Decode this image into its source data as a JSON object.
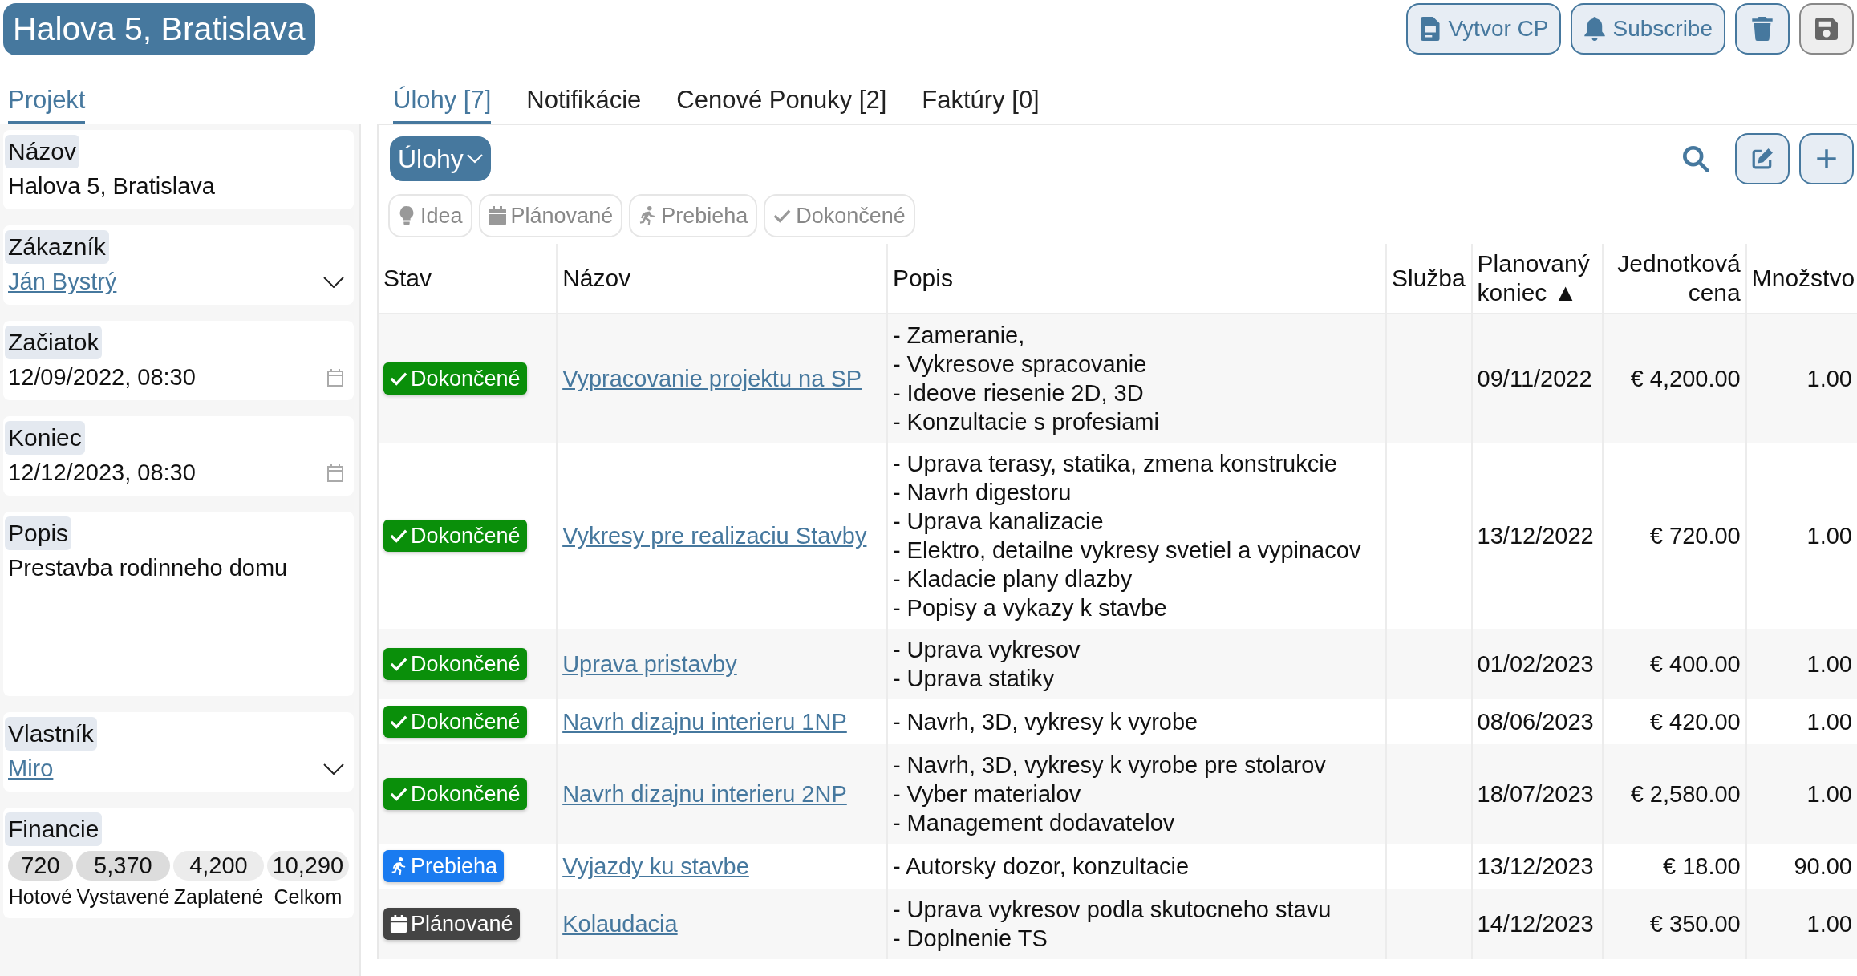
{
  "title": "Halova 5, Bratislava",
  "actions": [
    {
      "label": "Vytvor CP",
      "kind": "document"
    },
    {
      "label": "Subscribe",
      "kind": "bell"
    },
    {
      "kind": "trash"
    },
    {
      "kind": "save"
    }
  ],
  "sidebar": {
    "tabs": [
      {
        "label": "Projekt",
        "selected": true
      }
    ],
    "fields": [
      {
        "label": "Názov",
        "kind": "text",
        "value": "Halova 5, Bratislava"
      },
      {
        "label": "Zákazník",
        "kind": "link_select",
        "value": "Ján Bystrý"
      },
      {
        "label": "Začiatok",
        "kind": "date",
        "value": "12/09/2022, 08:30"
      },
      {
        "label": "Koniec",
        "kind": "date",
        "value": "12/12/2023, 08:30"
      },
      {
        "label": "Popis",
        "kind": "textarea",
        "value": "Prestavba rodinneho domu"
      },
      {
        "label": "Vlastník",
        "kind": "link_select",
        "value": "Miro"
      }
    ],
    "finance": {
      "label": "Financie",
      "items": [
        {
          "value": "720",
          "caption": "Hotové",
          "color": "#dcdcdc"
        },
        {
          "value": "5,370",
          "caption": "Vystavené",
          "color": "#dcdcdc"
        },
        {
          "value": "4,200",
          "caption": "Zaplatené",
          "color": "#ececec"
        },
        {
          "value": "10,290",
          "caption": "Celkom",
          "color": "#ececec"
        }
      ]
    }
  },
  "tabs": [
    {
      "label": "Úlohy [7]",
      "selected": true
    },
    {
      "label": "Notifikácie",
      "selected": false
    },
    {
      "label": "Cenové Ponuky [2]",
      "selected": false
    },
    {
      "label": "Faktúry [0]",
      "selected": false
    }
  ],
  "view_dropdown": "Úlohy",
  "filters": [
    {
      "label": "Idea",
      "kind": "idea"
    },
    {
      "label": "Plánované",
      "kind": "planned"
    },
    {
      "label": "Prebieha",
      "kind": "in_progress"
    },
    {
      "label": "Dokončené",
      "kind": "done"
    }
  ],
  "table": {
    "columns": [
      {
        "label": "Stav",
        "kind": "text"
      },
      {
        "label": "Názov",
        "kind": "text"
      },
      {
        "label": "Popis",
        "kind": "text"
      },
      {
        "label": "Služba",
        "kind": "text"
      },
      {
        "label": "Planovaný koniec",
        "kind": "text",
        "sort_mark": "▲"
      },
      {
        "label": "Jednotková cena",
        "kind": "numeric"
      },
      {
        "label": "Množstvo",
        "kind": "numeric"
      }
    ],
    "rows": [
      {
        "status": {
          "label": "Dokončené",
          "kind": "done"
        },
        "name": "Vypracovanie projektu na SP",
        "description": [
          "- Zameranie,",
          "- Vykresove spracovanie",
          "- Ideove riesenie 2D, 3D",
          "- Konzultacie s profesiami"
        ],
        "end": "09/11/2022",
        "price": "€ 4,200.00",
        "quantity": "1.00"
      },
      {
        "status": {
          "label": "Dokončené",
          "kind": "done"
        },
        "name": "Vykresy pre realizaciu Stavby",
        "description": [
          "- Uprava terasy, statika, zmena konstrukcie",
          "- Navrh digestoru",
          "- Uprava kanalizacie",
          "- Elektro, detailne vykresy svetiel a vypinacov",
          "- Kladacie plany dlazby",
          "- Popisy a vykazy k stavbe"
        ],
        "end": "13/12/2022",
        "price": "€ 720.00",
        "quantity": "1.00"
      },
      {
        "status": {
          "label": "Dokončené",
          "kind": "done"
        },
        "name": "Uprava pristavby",
        "description": [
          "- Uprava vykresov",
          "- Uprava statiky"
        ],
        "end": "01/02/2023",
        "price": "€ 400.00",
        "quantity": "1.00"
      },
      {
        "status": {
          "label": "Dokončené",
          "kind": "done"
        },
        "name": "Navrh dizajnu interieru 1NP",
        "description": [
          "- Navrh, 3D, vykresy k vyrobe"
        ],
        "end": "08/06/2023",
        "price": "€ 420.00",
        "quantity": "1.00"
      },
      {
        "status": {
          "label": "Dokončené",
          "kind": "done"
        },
        "name": "Navrh dizajnu interieru 2NP",
        "description": [
          "- Navrh, 3D, vykresy k vyrobe pre stolarov",
          "- Vyber materialov",
          "- Management dodavatelov"
        ],
        "end": "18/07/2023",
        "price": "€ 2,580.00",
        "quantity": "1.00"
      },
      {
        "status": {
          "label": "Prebieha",
          "kind": "in_progress"
        },
        "name": "Vyjazdy ku stavbe",
        "description": [
          "- Autorsky dozor,  konzultacie"
        ],
        "end": "13/12/2023",
        "price": "€ 18.00",
        "quantity": "90.00"
      },
      {
        "status": {
          "label": "Plánované",
          "kind": "planned"
        },
        "name": "Kolaudacia",
        "description": [
          "- Uprava vykresov podla skutocneho stavu",
          "- Doplnenie TS"
        ],
        "end": "14/12/2023",
        "price": "€ 350.00",
        "quantity": "1.00"
      }
    ]
  }
}
